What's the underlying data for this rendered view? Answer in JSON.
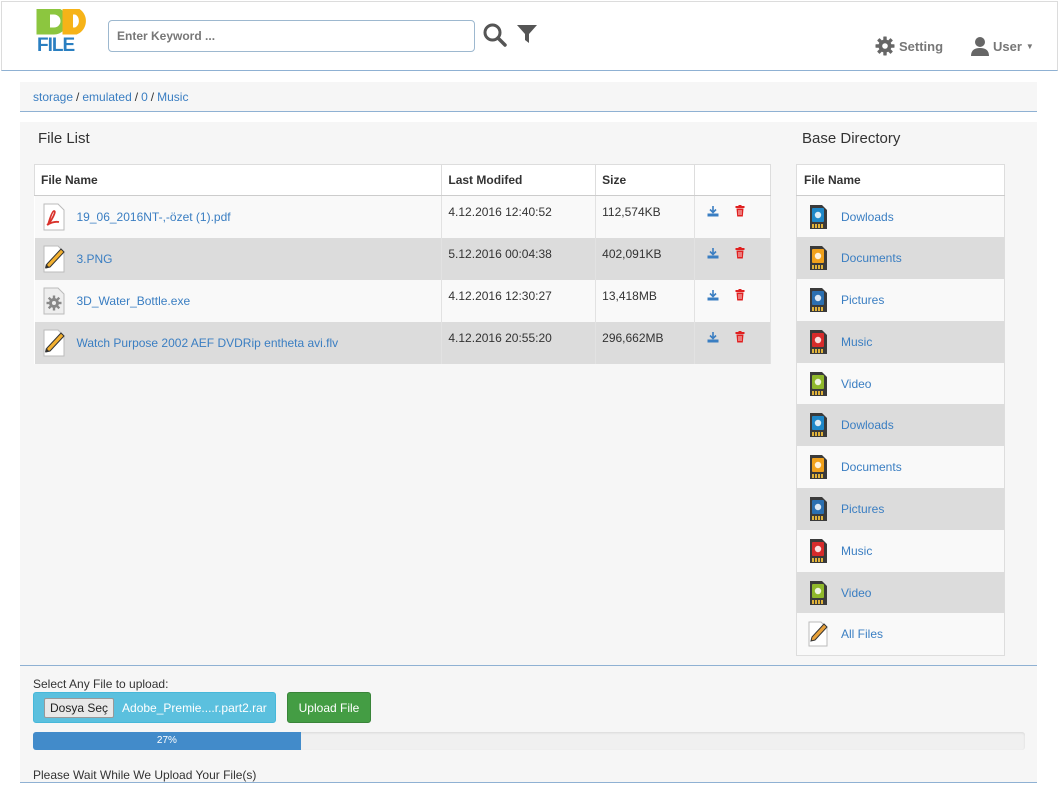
{
  "header": {
    "logo_text": "RD FILE",
    "search_placeholder": "Enter Keyword ...",
    "setting_label": "Setting",
    "user_label": "User"
  },
  "breadcrumb": [
    "storage",
    "emulated",
    "0",
    "Music"
  ],
  "file_list": {
    "title": "File List",
    "columns": [
      "File Name",
      "Last Modifed",
      "Size"
    ],
    "rows": [
      {
        "name": "19_06_2016NT-,-özet (1).pdf",
        "modified": "4.12.2016 12:40:52",
        "size": "112,574KB",
        "icon": "pdf-icon"
      },
      {
        "name": "3.PNG",
        "modified": "5.12.2016 00:04:38",
        "size": "402,091KB",
        "icon": "pencil-file-icon"
      },
      {
        "name": "3D_Water_Bottle.exe",
        "modified": "4.12.2016 12:30:27",
        "size": "13,418MB",
        "icon": "exe-gear-icon"
      },
      {
        "name": "Watch Purpose 2002 AEF DVDRip entheta avi.flv",
        "modified": "4.12.2016 20:55:20",
        "size": "296,662MB",
        "icon": "pencil-file-icon"
      }
    ]
  },
  "base_directory": {
    "title": "Base Directory",
    "column": "File Name",
    "items": [
      {
        "label": "Dowloads",
        "icon": "downloads-sd-icon",
        "color": "#1e88c9"
      },
      {
        "label": "Documents",
        "icon": "documents-sd-icon",
        "color": "#f0a11c"
      },
      {
        "label": "Pictures",
        "icon": "pictures-sd-icon",
        "color": "#2b6fb0"
      },
      {
        "label": "Music",
        "icon": "music-sd-icon",
        "color": "#d62b2b"
      },
      {
        "label": "Video",
        "icon": "video-sd-icon",
        "color": "#8fb82b"
      },
      {
        "label": "Dowloads",
        "icon": "downloads-sd-icon",
        "color": "#1e88c9"
      },
      {
        "label": "Documents",
        "icon": "documents-sd-icon",
        "color": "#f0a11c"
      },
      {
        "label": "Pictures",
        "icon": "pictures-sd-icon",
        "color": "#2b6fb0"
      },
      {
        "label": "Music",
        "icon": "music-sd-icon",
        "color": "#d62b2b"
      },
      {
        "label": "Video",
        "icon": "video-sd-icon",
        "color": "#8fb82b"
      },
      {
        "label": "All Files",
        "icon": "pencil-file-icon",
        "color": "#e8a13a"
      }
    ]
  },
  "upload": {
    "label": "Select Any File to upload:",
    "choose_label": "Dosya Seç",
    "chosen_file": "Adobe_Premie....r.part2.rar",
    "button_label": "Upload File",
    "progress_percent": 27,
    "progress_text": "27%",
    "status": "Please Wait While We Upload Your File(s)"
  },
  "colors": {
    "link": "#3a7ec2",
    "download_icon": "#3a7ec2",
    "delete_icon": "#e02020",
    "progress": "#428bca",
    "upload_button": "#449d44",
    "file_chooser": "#5bc0de"
  }
}
